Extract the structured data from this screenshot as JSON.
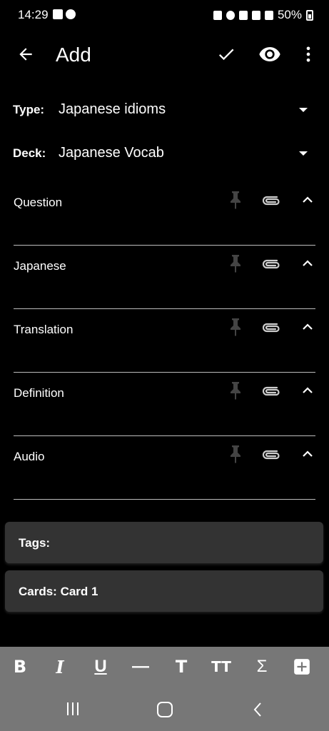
{
  "status_bar": {
    "time": "14:29",
    "battery": "50%"
  },
  "app_bar": {
    "title": "Add"
  },
  "note_type": {
    "label": "Type:",
    "value": "Japanese idioms"
  },
  "deck": {
    "label": "Deck:",
    "value": "Japanese Vocab"
  },
  "fields": [
    {
      "label": "Question"
    },
    {
      "label": "Japanese"
    },
    {
      "label": "Translation"
    },
    {
      "label": "Definition"
    },
    {
      "label": "Audio"
    }
  ],
  "tags": {
    "label": "Tags:"
  },
  "cards": {
    "label": "Cards: Card 1"
  },
  "toolbar": {
    "bold": "B",
    "italic": "I",
    "underline": "U",
    "horizontal_rule": "—",
    "title": "T",
    "font_size": "TT",
    "mathjax": "Σ"
  }
}
